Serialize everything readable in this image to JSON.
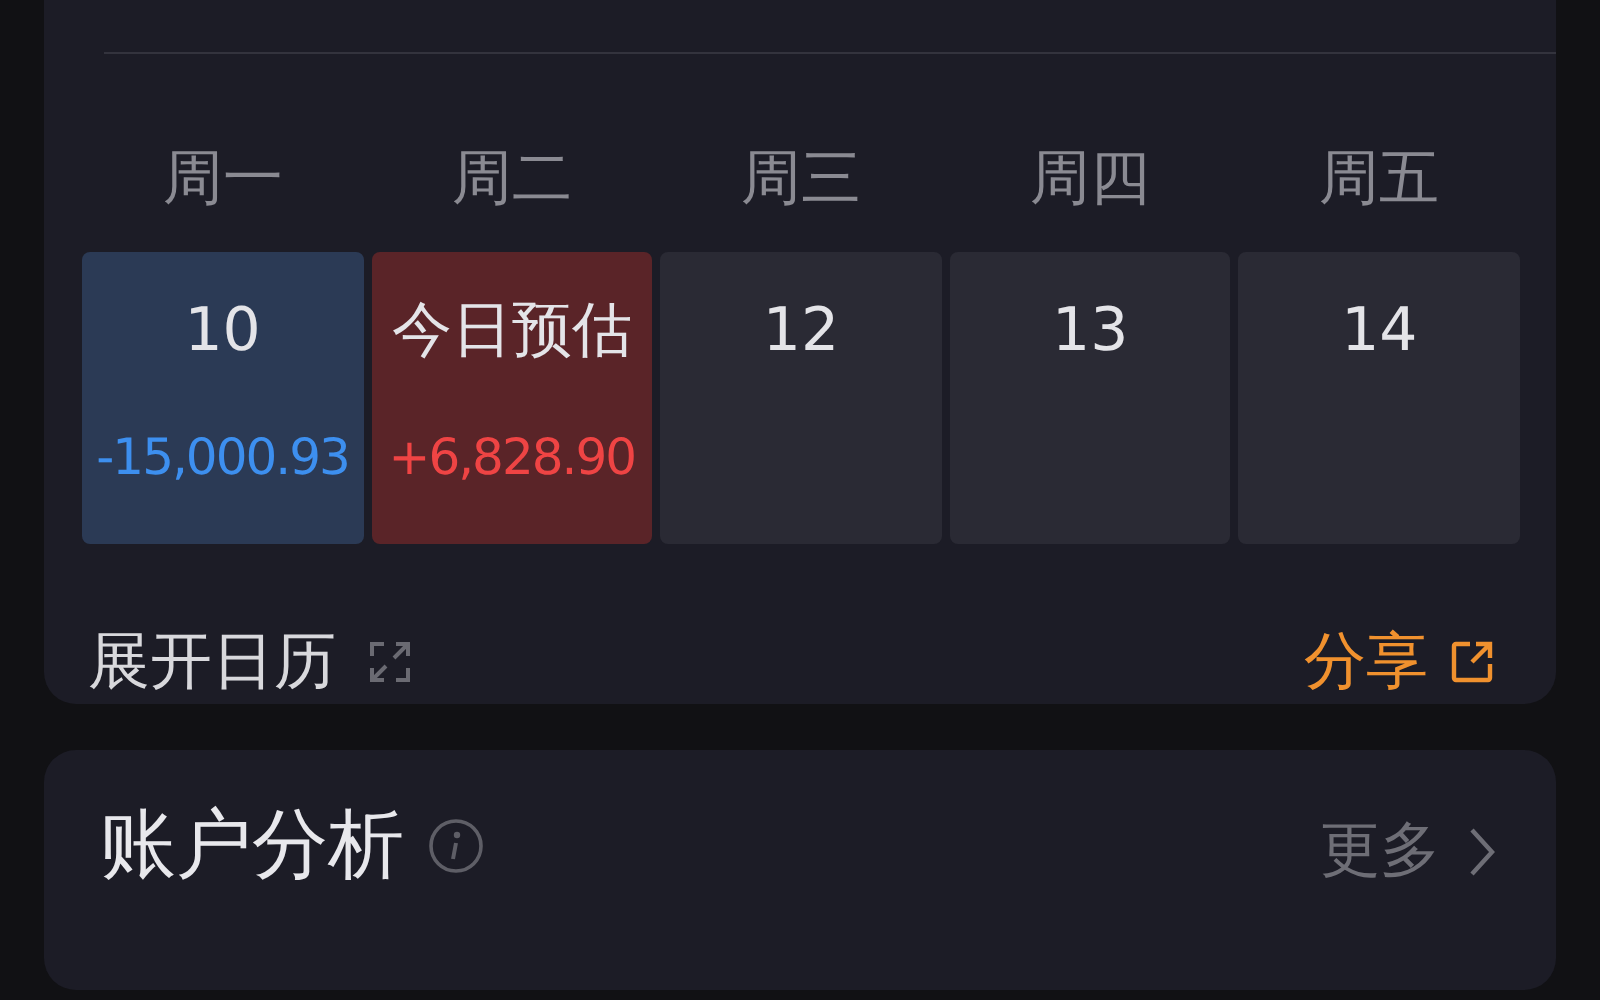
{
  "calendar": {
    "weekdays": [
      "周一",
      "周二",
      "周三",
      "周四",
      "周五"
    ],
    "days": [
      {
        "label": "10",
        "amount": "-15,000.93",
        "kind": "loss"
      },
      {
        "label": "今日预估",
        "amount": "+6,828.90",
        "kind": "gain"
      },
      {
        "label": "12",
        "kind": "plain"
      },
      {
        "label": "13",
        "kind": "plain"
      },
      {
        "label": "14",
        "kind": "plain"
      }
    ],
    "expand_label": "展开日历",
    "share_label": "分享"
  },
  "account_analysis": {
    "title": "账户分析",
    "more_label": "更多"
  }
}
